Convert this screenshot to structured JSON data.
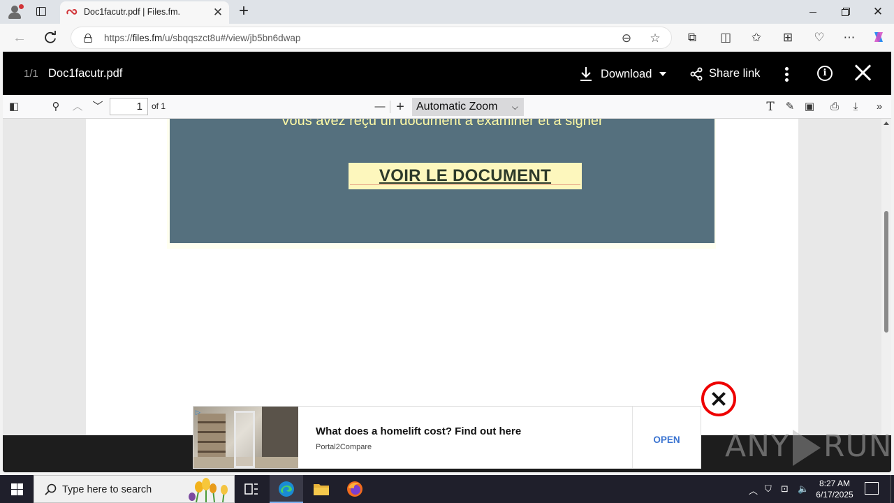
{
  "browser": {
    "tab_title": "Doc1facutr.pdf | Files.fm.",
    "url_prefix": "https://",
    "url_host": "files.fm",
    "url_path": "/u/sbqqszct8u#/view/jb5bn6dwap"
  },
  "viewer": {
    "page_indicator": "1/1",
    "filename": "Doc1facutr.pdf",
    "download_label": "Download",
    "share_label": "Share link"
  },
  "pdf_toolbar": {
    "page_value": "1",
    "page_total": "of 1",
    "zoom_value": "Automatic Zoom"
  },
  "document": {
    "banner_text": "Vous avez reçu un document à examiner et à signer",
    "button_label": "VOIR LE DOCUMENT",
    "banner_color": "#55707e",
    "text_color": "#fef9a5"
  },
  "ad": {
    "title": "What does a homelift cost? Find out here",
    "source": "Portal2Compare",
    "cta": "OPEN"
  },
  "watermark": {
    "left": "ANY",
    "right": "RUN"
  },
  "taskbar": {
    "search_placeholder": "Type here to search",
    "time": "8:27 AM",
    "date": "6/17/2025"
  }
}
